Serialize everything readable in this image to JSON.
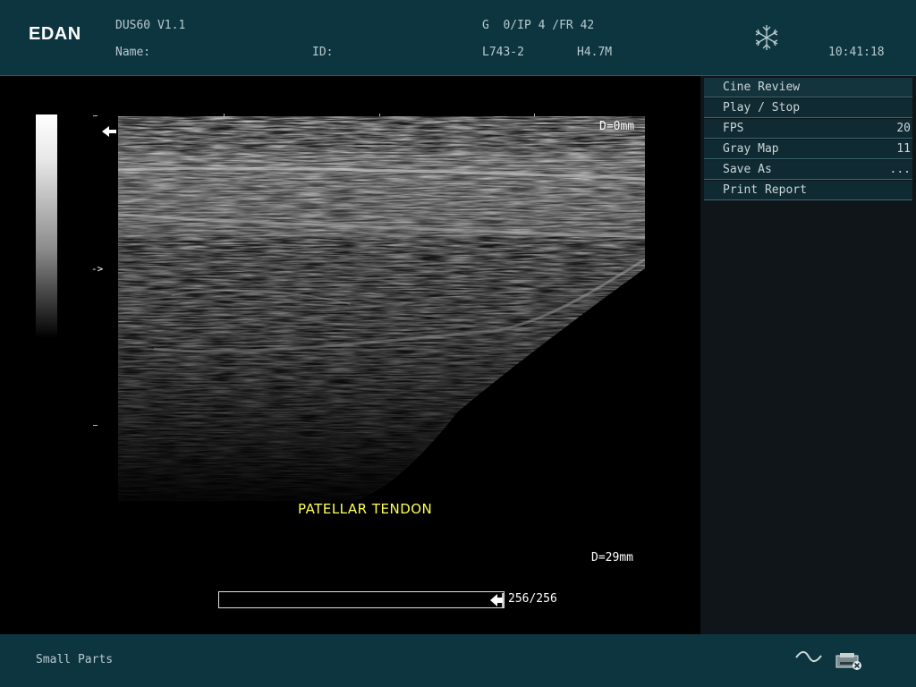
{
  "header": {
    "logo": "EDAN",
    "model": "DUS60 V1.1",
    "name_label": "Name:",
    "id_label": "ID:",
    "gain_info": "G  0/IP 4 /FR 42",
    "probe": "L743-2",
    "frequency": "H4.7M",
    "time": "10:41:18",
    "freeze_icon": "snowflake-icon"
  },
  "image": {
    "depth_top": "D=0mm",
    "depth_bottom": "D=29mm",
    "annotation": "PATELLAR TENDON",
    "focus_marker": "->",
    "cine_counter": "256/256",
    "cine_progress": 1.0
  },
  "menu": {
    "items": [
      {
        "label": "Cine Review",
        "value": ""
      },
      {
        "label": "Play / Stop",
        "value": ""
      },
      {
        "label": "FPS",
        "value": "20"
      },
      {
        "label": "Gray Map",
        "value": "11"
      },
      {
        "label": "Save As",
        "value": "..."
      },
      {
        "label": "Print Report",
        "value": ""
      }
    ]
  },
  "footer": {
    "exam_mode": "Small Parts",
    "icons": [
      "wave-icon",
      "printer-icon"
    ]
  }
}
